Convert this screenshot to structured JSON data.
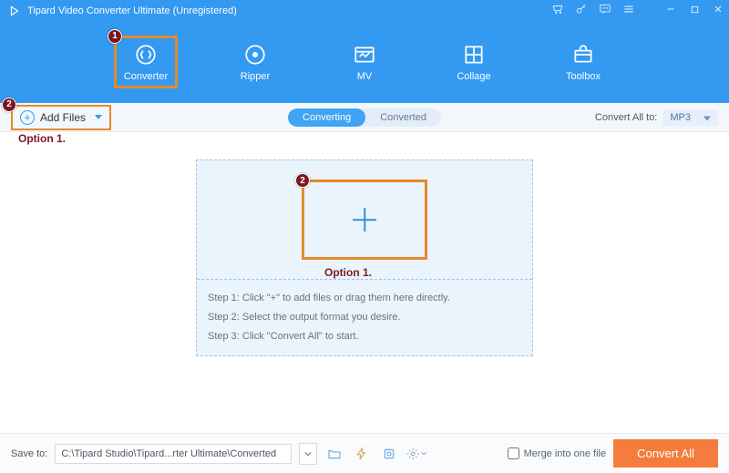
{
  "title": "Tipard Video Converter Ultimate (Unregistered)",
  "modules": {
    "converter": "Converter",
    "ripper": "Ripper",
    "mv": "MV",
    "collage": "Collage",
    "toolbox": "Toolbox"
  },
  "addFiles": "Add Files",
  "tabs": {
    "converting": "Converting",
    "converted": "Converted"
  },
  "convertAllLabel": "Convert All to:",
  "convertAllFormat": "MP3",
  "steps": {
    "s1": "Step 1: Click \"+\" to add files or drag them here directly.",
    "s2": "Step 2: Select the output format you desire.",
    "s3": "Step 3: Click \"Convert All\" to start."
  },
  "footer": {
    "saveTo": "Save to:",
    "path": "C:\\Tipard Studio\\Tipard...rter Ultimate\\Converted",
    "merge": "Merge into one file",
    "convertAll": "Convert All"
  },
  "annotations": {
    "badge1": "1",
    "badge2": "2",
    "opt1": "Option 1.",
    "opt2": "Option 1."
  }
}
